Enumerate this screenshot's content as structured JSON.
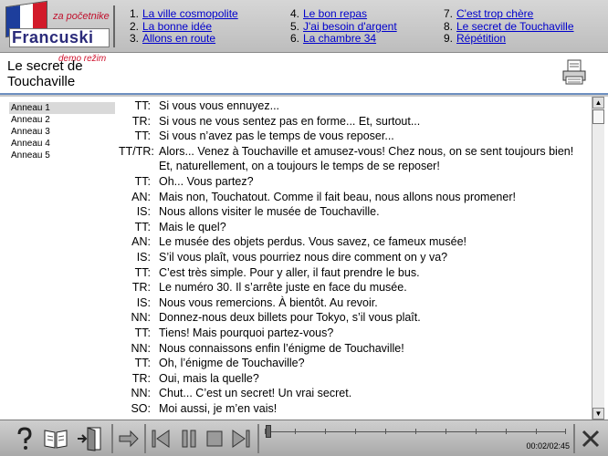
{
  "app": {
    "logo_small": "za početnike",
    "logo_big": "Francuski",
    "flag_colors": [
      "#1d3e9c",
      "#ffffff",
      "#d21a2a"
    ]
  },
  "nav": {
    "columns": [
      [
        {
          "num": "1.",
          "label": "La ville cosmopolite"
        },
        {
          "num": "2.",
          "label": "La bonne idée"
        },
        {
          "num": "3.",
          "label": "Allons en route"
        }
      ],
      [
        {
          "num": "4.",
          "label": "Le bon repas"
        },
        {
          "num": "5.",
          "label": "J'ai besoin d'argent"
        },
        {
          "num": "6.",
          "label": "La chambre 34"
        }
      ],
      [
        {
          "num": "7.",
          "label": "C'est trop chère"
        },
        {
          "num": "8.",
          "label": "Le secret de Touchaville"
        },
        {
          "num": "9.",
          "label": "Répétition"
        }
      ]
    ]
  },
  "lesson": {
    "title": "Le secret de Touchaville",
    "demo_tag": "demo režim",
    "print_icon": "printer-icon"
  },
  "sidebar": {
    "items": [
      {
        "label": "Anneau 1",
        "selected": true
      },
      {
        "label": "Anneau 2",
        "selected": false
      },
      {
        "label": "Anneau 3",
        "selected": false
      },
      {
        "label": "Anneau 4",
        "selected": false
      },
      {
        "label": "Anneau 5",
        "selected": false
      }
    ]
  },
  "dialogue": [
    {
      "speaker": "TT:",
      "text": "Si vous vous ennuyez..."
    },
    {
      "speaker": "TR:",
      "text": "Si vous ne vous sentez pas en forme... Et, surtout..."
    },
    {
      "speaker": "TT:",
      "text": "Si vous n’avez pas le temps de vous reposer..."
    },
    {
      "speaker": "TT/TR:",
      "text": "Alors... Venez à Touchaville et amusez-vous! Chez nous, on se sent toujours bien! Et, naturellement, on a toujours le temps de se reposer!"
    },
    {
      "speaker": "TT:",
      "text": "Oh... Vous partez?"
    },
    {
      "speaker": "AN:",
      "text": "Mais non, Touchatout. Comme il fait beau, nous allons nous promener!"
    },
    {
      "speaker": "IS:",
      "text": "Nous allons visiter le musée de Touchaville."
    },
    {
      "speaker": "TT:",
      "text": "Mais le quel?"
    },
    {
      "speaker": "AN:",
      "text": "Le musée des objets perdus. Vous savez, ce fameux musée!"
    },
    {
      "speaker": "IS:",
      "text": "S’il vous plaît, vous pourriez nous dire comment on y va?"
    },
    {
      "speaker": "TT:",
      "text": "C’est très simple. Pour y aller, il faut prendre le bus."
    },
    {
      "speaker": "TR:",
      "text": "Le numéro 30. Il s’arrête juste en face du musée."
    },
    {
      "speaker": "IS:",
      "text": "Nous vous remercions. À bientôt. Au revoir."
    },
    {
      "speaker": "NN:",
      "text": "Donnez-nous deux billets pour Tokyo, s’il vous plaît."
    },
    {
      "speaker": "TT:",
      "text": "Tiens! Mais pourquoi partez-vous?"
    },
    {
      "speaker": "NN:",
      "text": "Nous connaissons enfin l’énigme de Touchaville!"
    },
    {
      "speaker": "TT:",
      "text": "Oh, l’énigme de Touchaville?"
    },
    {
      "speaker": "TR:",
      "text": "Oui, mais la quelle?"
    },
    {
      "speaker": "NN:",
      "text": "Chut... C’est un secret! Un vrai secret."
    },
    {
      "speaker": "SO:",
      "text": "Moi aussi, je m’en vais!"
    }
  ],
  "player": {
    "time": "00:02/02:45",
    "progress": 0.01,
    "icons": {
      "help": "help-icon",
      "book": "book-icon",
      "exit": "exit-door-icon",
      "arrow": "arrow-right-icon",
      "prev": "skip-back-icon",
      "pause": "pause-icon",
      "stop": "stop-icon",
      "next": "skip-forward-icon",
      "close": "close-icon"
    }
  }
}
